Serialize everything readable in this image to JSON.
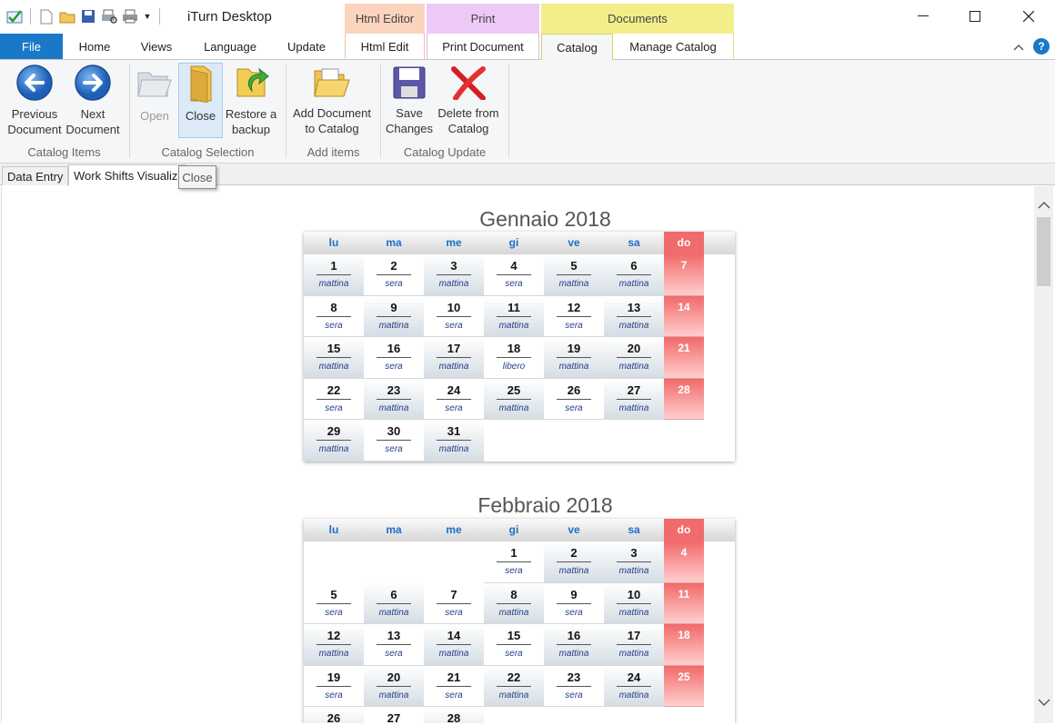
{
  "app": {
    "title": "iTurn Desktop"
  },
  "context_tabs": {
    "html_editor": "Html Editor",
    "print": "Print",
    "documents": "Documents"
  },
  "tabs": {
    "file": "File",
    "home": "Home",
    "views": "Views",
    "language": "Language",
    "update": "Update",
    "html_edit": "Html Edit",
    "print_document": "Print Document",
    "catalog": "Catalog",
    "manage_catalog": "Manage Catalog"
  },
  "ribbon": {
    "previous": [
      "Previous",
      "Document"
    ],
    "next": [
      "Next",
      "Document"
    ],
    "open": "Open",
    "close": "Close",
    "restore": [
      "Restore a",
      "backup"
    ],
    "add": [
      "Add Document",
      "to Catalog"
    ],
    "save": [
      "Save",
      "Changes"
    ],
    "delete": [
      "Delete from",
      "Catalog"
    ],
    "groups": {
      "catalog_items": "Catalog Items",
      "catalog_selection": "Catalog Selection",
      "add_items": "Add items",
      "catalog_update": "Catalog Update"
    }
  },
  "doc_tabs": {
    "data_entry": "Data Entry",
    "work_shifts": "Work Shifts Visualiz"
  },
  "tooltip": "Close",
  "colors": {
    "accent": "#1a78c9",
    "sunday": "#f06b6b",
    "weekday_header": "#1e6fc8"
  },
  "calendar": {
    "weekdays": [
      "lu",
      "ma",
      "me",
      "gi",
      "ve",
      "sa",
      "do"
    ],
    "months": [
      {
        "title": "Gennaio 2018",
        "weeks": [
          [
            [
              "1",
              "mattina"
            ],
            [
              "2",
              "sera"
            ],
            [
              "3",
              "mattina"
            ],
            [
              "4",
              "sera"
            ],
            [
              "5",
              "mattina"
            ],
            [
              "6",
              "mattina"
            ],
            [
              "7",
              ""
            ]
          ],
          [
            [
              "8",
              "sera"
            ],
            [
              "9",
              "mattina"
            ],
            [
              "10",
              "sera"
            ],
            [
              "11",
              "mattina"
            ],
            [
              "12",
              "sera"
            ],
            [
              "13",
              "mattina"
            ],
            [
              "14",
              ""
            ]
          ],
          [
            [
              "15",
              "mattina"
            ],
            [
              "16",
              "sera"
            ],
            [
              "17",
              "mattina"
            ],
            [
              "18",
              "libero"
            ],
            [
              "19",
              "mattina"
            ],
            [
              "20",
              "mattina"
            ],
            [
              "21",
              ""
            ]
          ],
          [
            [
              "22",
              "sera"
            ],
            [
              "23",
              "mattina"
            ],
            [
              "24",
              "sera"
            ],
            [
              "25",
              "mattina"
            ],
            [
              "26",
              "sera"
            ],
            [
              "27",
              "mattina"
            ],
            [
              "28",
              ""
            ]
          ],
          [
            [
              "29",
              "mattina"
            ],
            [
              "30",
              "sera"
            ],
            [
              "31",
              "mattina"
            ],
            null,
            null,
            null,
            null
          ]
        ]
      },
      {
        "title": "Febbraio 2018",
        "weeks": [
          [
            null,
            null,
            null,
            [
              "1",
              "sera"
            ],
            [
              "2",
              "mattina"
            ],
            [
              "3",
              "mattina"
            ],
            [
              "4",
              ""
            ]
          ],
          [
            [
              "5",
              "sera"
            ],
            [
              "6",
              "mattina"
            ],
            [
              "7",
              "sera"
            ],
            [
              "8",
              "mattina"
            ],
            [
              "9",
              "sera"
            ],
            [
              "10",
              "mattina"
            ],
            [
              "11",
              ""
            ]
          ],
          [
            [
              "12",
              "mattina"
            ],
            [
              "13",
              "sera"
            ],
            [
              "14",
              "mattina"
            ],
            [
              "15",
              "sera"
            ],
            [
              "16",
              "mattina"
            ],
            [
              "17",
              "mattina"
            ],
            [
              "18",
              ""
            ]
          ],
          [
            [
              "19",
              "sera"
            ],
            [
              "20",
              "mattina"
            ],
            [
              "21",
              "sera"
            ],
            [
              "22",
              "mattina"
            ],
            [
              "23",
              "sera"
            ],
            [
              "24",
              "mattina"
            ],
            [
              "25",
              ""
            ]
          ],
          [
            [
              "26",
              ""
            ],
            [
              "27",
              ""
            ],
            [
              "28",
              ""
            ],
            null,
            null,
            null,
            null
          ]
        ]
      }
    ]
  }
}
